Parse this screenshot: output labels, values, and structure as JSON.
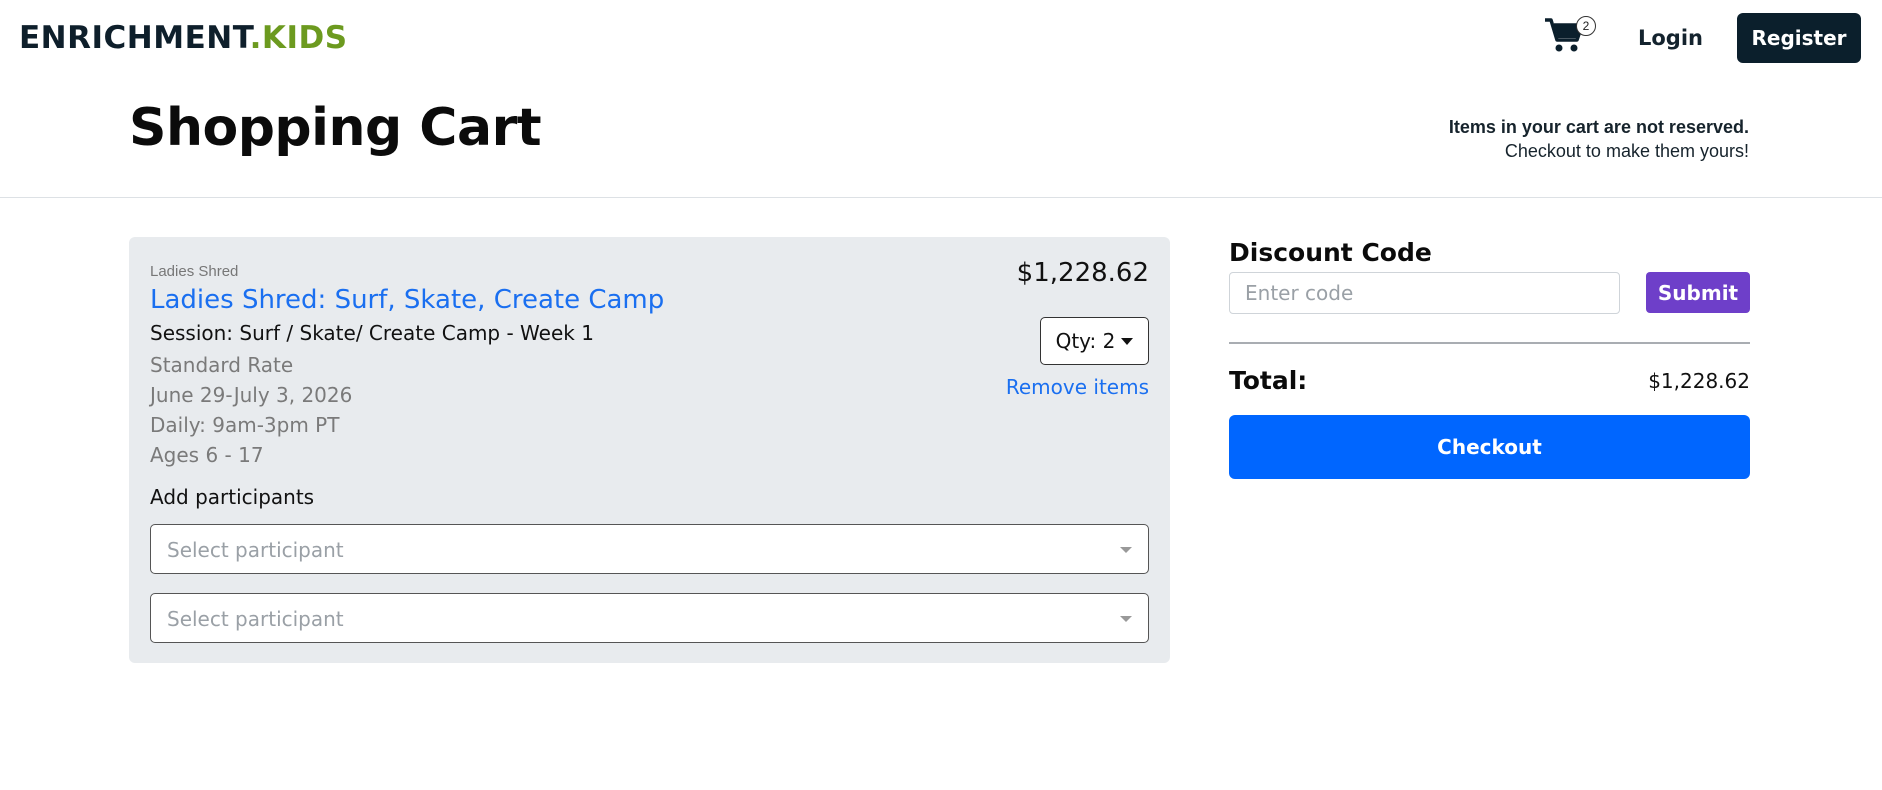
{
  "brand": {
    "name_part1": "ENRICHMENT",
    "dot": ".",
    "name_part2": "KIDS",
    "accent_color": "#6c9a1f"
  },
  "header": {
    "cart_count": "2",
    "login_label": "Login",
    "register_label": "Register"
  },
  "page": {
    "title": "Shopping Cart",
    "notice_line1": "Items in your cart are not reserved.",
    "notice_line2": "Checkout to make them yours!"
  },
  "cart_item": {
    "vendor": "Ladies Shred",
    "title": "Ladies Shred: Surf, Skate, Create Camp",
    "session": "Session: Surf / Skate/ Create Camp - Week 1",
    "rate": "Standard Rate",
    "dates": "June 29-July 3, 2026",
    "daily": "Daily: 9am-3pm PT",
    "ages": "Ages 6 - 17",
    "price": "$1,228.62",
    "qty_label": "Qty: 2",
    "remove_label": "Remove items",
    "add_participants_label": "Add participants",
    "participants": [
      {
        "placeholder": "Select participant"
      },
      {
        "placeholder": "Select participant"
      }
    ]
  },
  "summary": {
    "discount_heading": "Discount Code",
    "discount_placeholder": "Enter code",
    "submit_label": "Submit",
    "total_label": "Total:",
    "total_value": "$1,228.62",
    "checkout_label": "Checkout"
  },
  "colors": {
    "link": "#1a6ff0",
    "checkout": "#0066ff",
    "submit": "#6e3fc9",
    "dark": "#0b1f2c",
    "card": "#e8ebee"
  }
}
